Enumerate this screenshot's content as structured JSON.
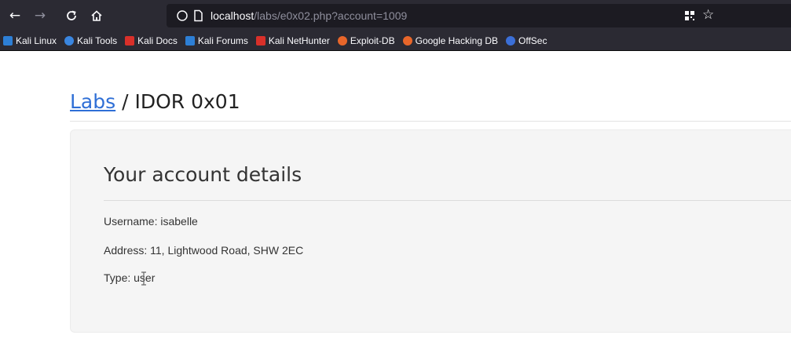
{
  "browser": {
    "nav": {
      "back_icon": "←",
      "forward_icon": "→",
      "reload_icon": "C",
      "home_icon": "⌂"
    },
    "url": {
      "host": "localhost",
      "path": "/labs/e0x02.php?account=1009"
    },
    "icons": {
      "star": "☆"
    }
  },
  "bookmarks": [
    {
      "label": "Kali Linux",
      "color": "#2d7fd6"
    },
    {
      "label": "Kali Tools",
      "color": "#3a86e0"
    },
    {
      "label": "Kali Docs",
      "color": "#d9302a"
    },
    {
      "label": "Kali Forums",
      "color": "#2d7fd6"
    },
    {
      "label": "Kali NetHunter",
      "color": "#d9302a"
    },
    {
      "label": "Exploit-DB",
      "color": "#e8662a"
    },
    {
      "label": "Google Hacking DB",
      "color": "#e8662a"
    },
    {
      "label": "OffSec",
      "color": "#3b6fd8"
    }
  ],
  "page": {
    "breadcrumb": {
      "link": "Labs",
      "separator": " / ",
      "current": "IDOR 0x01"
    },
    "card": {
      "title": "Your account details",
      "username": "Username: isabelle",
      "address": "Address: 11, Lightwood Road, SHW 2EC",
      "type": "Type: user"
    }
  }
}
